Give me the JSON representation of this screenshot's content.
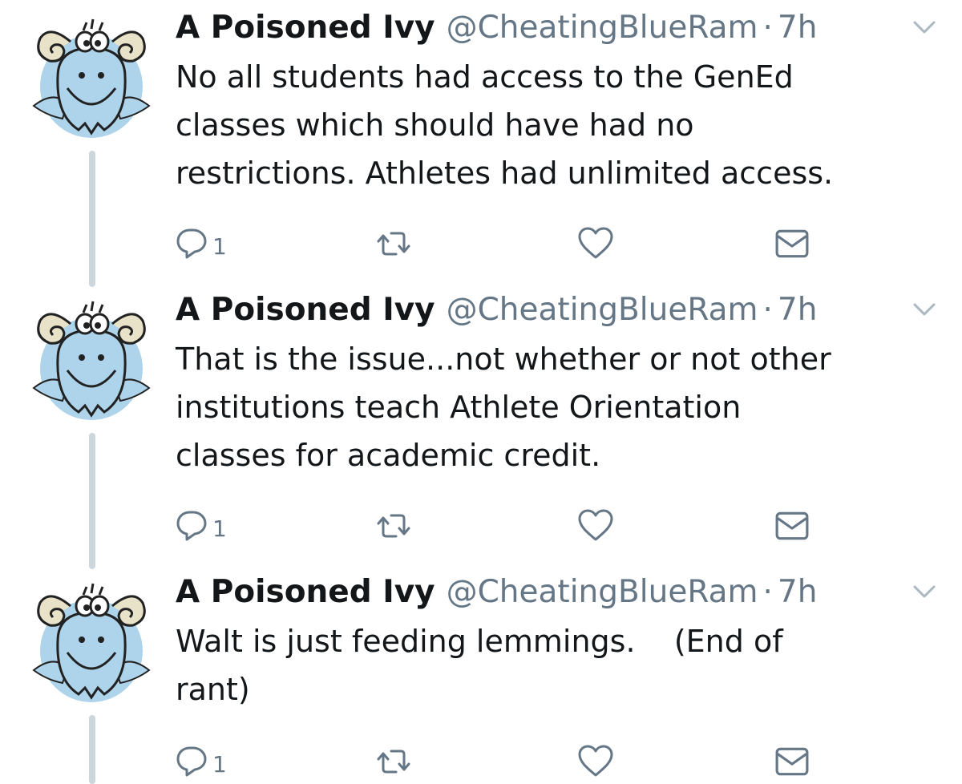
{
  "tweets": [
    {
      "name": "A Poisoned Ivy",
      "handle": "@CheatingBlueRam",
      "separator": "·",
      "time": "7h",
      "text": "No all students had access to the GenEd\nclasses which should have had no\nrestrictions. Athletes had unlimited access.",
      "reply_count": "1"
    },
    {
      "name": "A Poisoned Ivy",
      "handle": "@CheatingBlueRam",
      "separator": "·",
      "time": "7h",
      "text": "That is the issue...not whether or not other\ninstitutions teach Athlete Orientation\nclasses for academic credit.",
      "reply_count": "1"
    },
    {
      "name": "A Poisoned Ivy",
      "handle": "@CheatingBlueRam",
      "separator": "·",
      "time": "7h",
      "text": "Walt is just feeding lemmings.    (End of\nrant)",
      "reply_count": "1"
    }
  ],
  "colors": {
    "text": "#14171a",
    "secondary": "#657786",
    "thread_line": "#ccd6dd",
    "avatar_bg": "#aed4ec"
  },
  "icons": [
    "ram-avatar",
    "chevron-down-icon",
    "reply-icon",
    "retweet-icon",
    "like-icon",
    "direct-message-icon"
  ]
}
